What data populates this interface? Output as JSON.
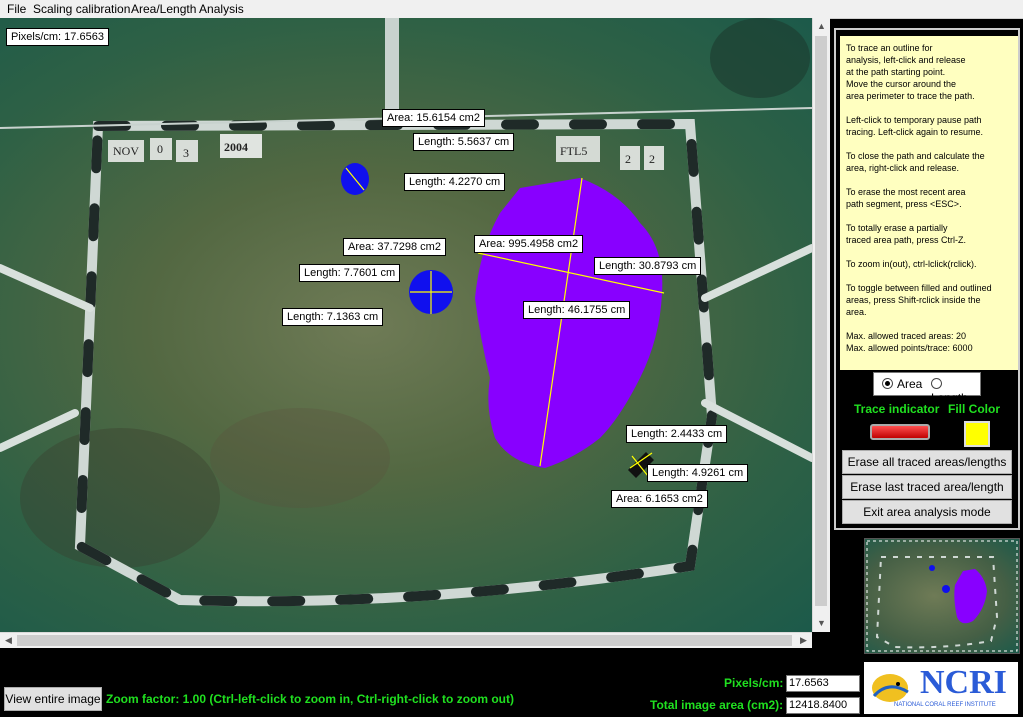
{
  "menu": {
    "items": [
      "File",
      "Scaling calibration",
      "Area/Length Analysis"
    ]
  },
  "image": {
    "pixels_per_cm_label": "Pixels/cm: 17.6563",
    "tag_texts": [
      "NOV",
      "0",
      "3",
      "2004",
      "FTL5",
      "2",
      "2"
    ],
    "measurements": [
      "Area: 15.6154 cm2",
      "Length: 5.5637 cm",
      "Length: 4.2270 cm",
      "Area: 37.7298 cm2",
      "Area: 995.4958 cm2",
      "Length: 7.7601 cm",
      "Length: 30.8793 cm",
      "Length: 46.1755 cm",
      "Length: 7.1363 cm",
      "Length: 2.4433 cm",
      "Length: 4.9261 cm",
      "Area: 6.1653 cm2"
    ]
  },
  "panel": {
    "instructions": [
      "To trace an outline for\nanalysis, left-click and release\nat the path starting point.\nMove the cursor around the\narea perimeter to trace the path.",
      "Left-click to temporary pause path\ntracing. Left-click again to resume.",
      "To close the path and calculate the\narea, right-click and release.",
      "To erase the most recent area\npath segment, press <ESC>.",
      "To totally erase a partially\ntraced area path, press Ctrl-Z.",
      "To zoom in(out), ctrl-lclick(rclick).",
      "To toggle between filled and outlined\nareas, press Shift-rclick inside the\narea.",
      "Max. allowed traced areas: 20\nMax. allowed points/trace: 6000"
    ],
    "mode_area": "Area",
    "mode_length": "Length",
    "trace_indicator": "Trace indicator",
    "fill_color": "Fill Color",
    "fill_color_value": "#ffff00",
    "btn_erase_all": "Erase all traced areas/lengths",
    "btn_erase_last": "Erase last traced area/length",
    "btn_exit": "Exit area analysis mode"
  },
  "bottom": {
    "view_entire": "View entire image",
    "zoom_text": "Zoom factor: 1.00  (Ctrl-left-click to zoom in, Ctrl-right-click to zoom out)",
    "pixels_cm_label": "Pixels/cm:",
    "pixels_cm_value": "17.6563",
    "total_area_label": "Total image area (cm2):",
    "total_area_value": "12418.8400"
  },
  "logo": {
    "text": "NCRI",
    "subtitle": "NATIONAL CORAL REEF INSTITUTE"
  }
}
